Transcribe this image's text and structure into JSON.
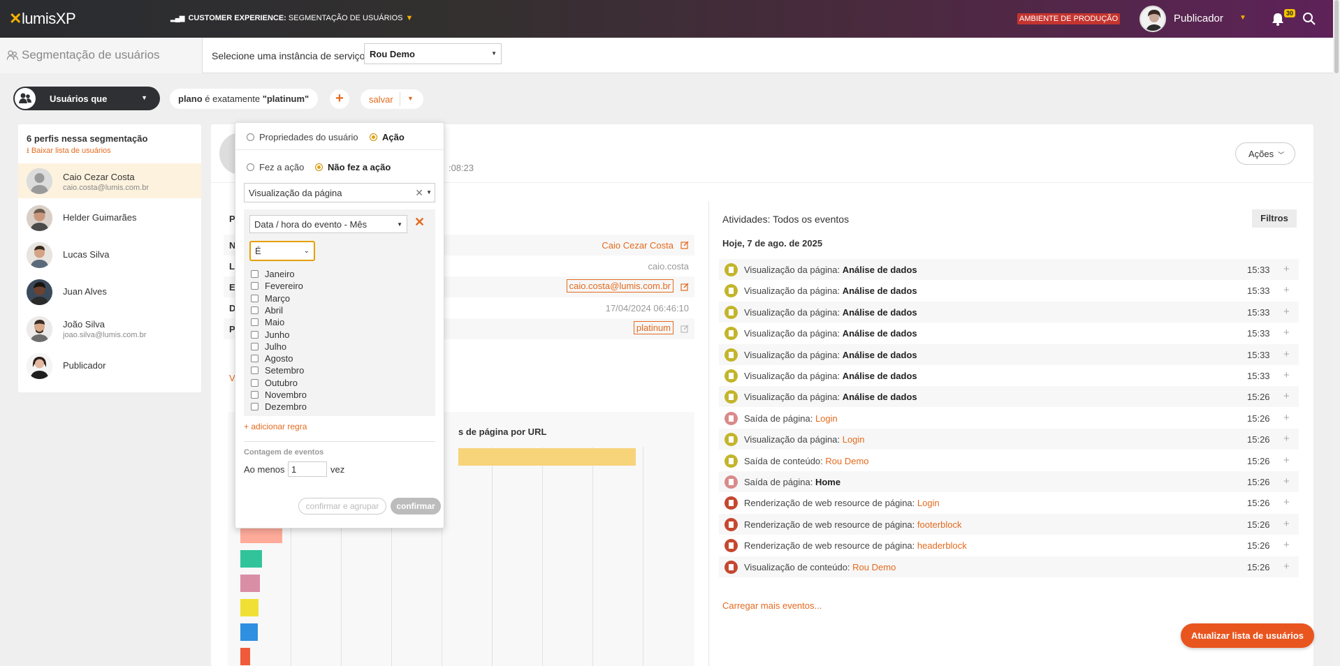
{
  "header": {
    "logo": "lumisXP",
    "logo_x": "x",
    "logo_rest": "lumisXP",
    "breadcrumb_section": "CUSTOMER EXPERIENCE:",
    "breadcrumb_page": "SEGMENTAÇÃO DE USUÁRIOS",
    "environment": "AMBIENTE DE PRODUÇÃO",
    "user_name": "Publicador",
    "notification_count": "30"
  },
  "subheader": {
    "title": "Segmentação de usuários",
    "instance_label": "Selecione uma instância de serviço:",
    "instance_value": "Rou Demo"
  },
  "filter_bar": {
    "users_label": "Usuários que",
    "rule_field": "plano",
    "rule_operator": "é exatamente",
    "rule_value": "\"platinum\"",
    "add_label": "+",
    "save_label": "salvar"
  },
  "left_panel": {
    "count_label": "6 perfis nessa segmentação",
    "download_label": "Baixar lista de usuários",
    "users": [
      {
        "name": "Caio Cezar Costa",
        "email": "caio.costa@lumis.com.br"
      },
      {
        "name": "Helder Guimarães",
        "email": ""
      },
      {
        "name": "Lucas Silva",
        "email": ""
      },
      {
        "name": "Juan Alves",
        "email": ""
      },
      {
        "name": "João Silva",
        "email": "joao.silva@lumis.com.br"
      },
      {
        "name": "Publicador",
        "email": ""
      }
    ]
  },
  "profile": {
    "date_fragment": ":08:23",
    "actions_label": "Ações",
    "section_letter": "P",
    "rows": [
      {
        "key": "N",
        "value": "Caio Cezar Costa"
      },
      {
        "key": "L",
        "value": "caio.costa"
      },
      {
        "key": "E",
        "value": "caio.costa@lumis.com.br"
      },
      {
        "key": "D",
        "value": "17/04/2024 06:46:10"
      },
      {
        "key": "P",
        "value": "platinum"
      }
    ],
    "more_link_letter": "V",
    "chart_title": "s de página por URL"
  },
  "activities": {
    "title": "Atividades: Todos os eventos",
    "filters_label": "Filtros",
    "date_label": "Hoje, 7 de ago. de 2025",
    "more_label": "Carregar mais eventos...",
    "events": [
      {
        "type": "Visualização da página:",
        "target": "Análise de dados",
        "time": "15:33",
        "style": "bold",
        "icon_color": "#c3b52b"
      },
      {
        "type": "Visualização da página:",
        "target": "Análise de dados",
        "time": "15:33",
        "style": "bold",
        "icon_color": "#c3b52b"
      },
      {
        "type": "Visualização da página:",
        "target": "Análise de dados",
        "time": "15:33",
        "style": "bold",
        "icon_color": "#c3b52b"
      },
      {
        "type": "Visualização da página:",
        "target": "Análise de dados",
        "time": "15:33",
        "style": "bold",
        "icon_color": "#c3b52b"
      },
      {
        "type": "Visualização da página:",
        "target": "Análise de dados",
        "time": "15:33",
        "style": "bold",
        "icon_color": "#c3b52b"
      },
      {
        "type": "Visualização da página:",
        "target": "Análise de dados",
        "time": "15:33",
        "style": "bold",
        "icon_color": "#c3b52b"
      },
      {
        "type": "Visualização da página:",
        "target": "Análise de dados",
        "time": "15:26",
        "style": "bold",
        "icon_color": "#c3b52b"
      },
      {
        "type": "Saída de página:",
        "target": "Login",
        "time": "15:26",
        "style": "link",
        "icon_color": "#d98a8a"
      },
      {
        "type": "Visualização da página:",
        "target": "Login",
        "time": "15:26",
        "style": "link",
        "icon_color": "#c3b52b"
      },
      {
        "type": "Saída de conteúdo:",
        "target": "Rou Demo",
        "time": "15:26",
        "style": "link",
        "icon_color": "#c3b52b"
      },
      {
        "type": "Saída de página:",
        "target": "Home",
        "time": "15:26",
        "style": "bold",
        "icon_color": "#d98a8a"
      },
      {
        "type": "Renderização de web resource de página:",
        "target": "Login",
        "time": "15:26",
        "style": "link",
        "icon_color": "#c6472f"
      },
      {
        "type": "Renderização de web resource de página:",
        "target": "footerblock",
        "time": "15:26",
        "style": "link",
        "icon_color": "#c6472f"
      },
      {
        "type": "Renderização de web resource de página:",
        "target": "headerblock",
        "time": "15:26",
        "style": "link",
        "icon_color": "#c6472f"
      },
      {
        "type": "Visualização de conteúdo:",
        "target": "Rou Demo",
        "time": "15:26",
        "style": "link",
        "icon_color": "#c6472f"
      }
    ]
  },
  "update_button": "Atualizar lista de usuários",
  "popover": {
    "tab_user_props": "Propriedades do usuário",
    "tab_action": "Ação",
    "did_action": "Fez a ação",
    "not_did_action": "Não fez a ação",
    "action_value": "Visualização da página",
    "field_value": "Data / hora do evento - Mês",
    "operator_value": "É",
    "months": [
      "Janeiro",
      "Fevereiro",
      "Março",
      "Abril",
      "Maio",
      "Junho",
      "Julho",
      "Agosto",
      "Setembro",
      "Outubro",
      "Novembro",
      "Dezembro"
    ],
    "add_rule": "+ adicionar regra",
    "count_label": "Contagem de eventos",
    "at_least": "Ao menos",
    "count_value": "1",
    "times": "vez",
    "confirm_group": "confirmar e agrupar",
    "confirm": "confirmar"
  },
  "chart_data": {
    "type": "bar",
    "title": "s de página por URL",
    "orientation": "horizontal",
    "bar_colors": [
      "#f7d37a",
      "#0f9aa6",
      "#ffab9a",
      "#31c49a",
      "#d98ea6",
      "#f0e035",
      "#2f8fe0",
      "#f05a3a"
    ]
  }
}
